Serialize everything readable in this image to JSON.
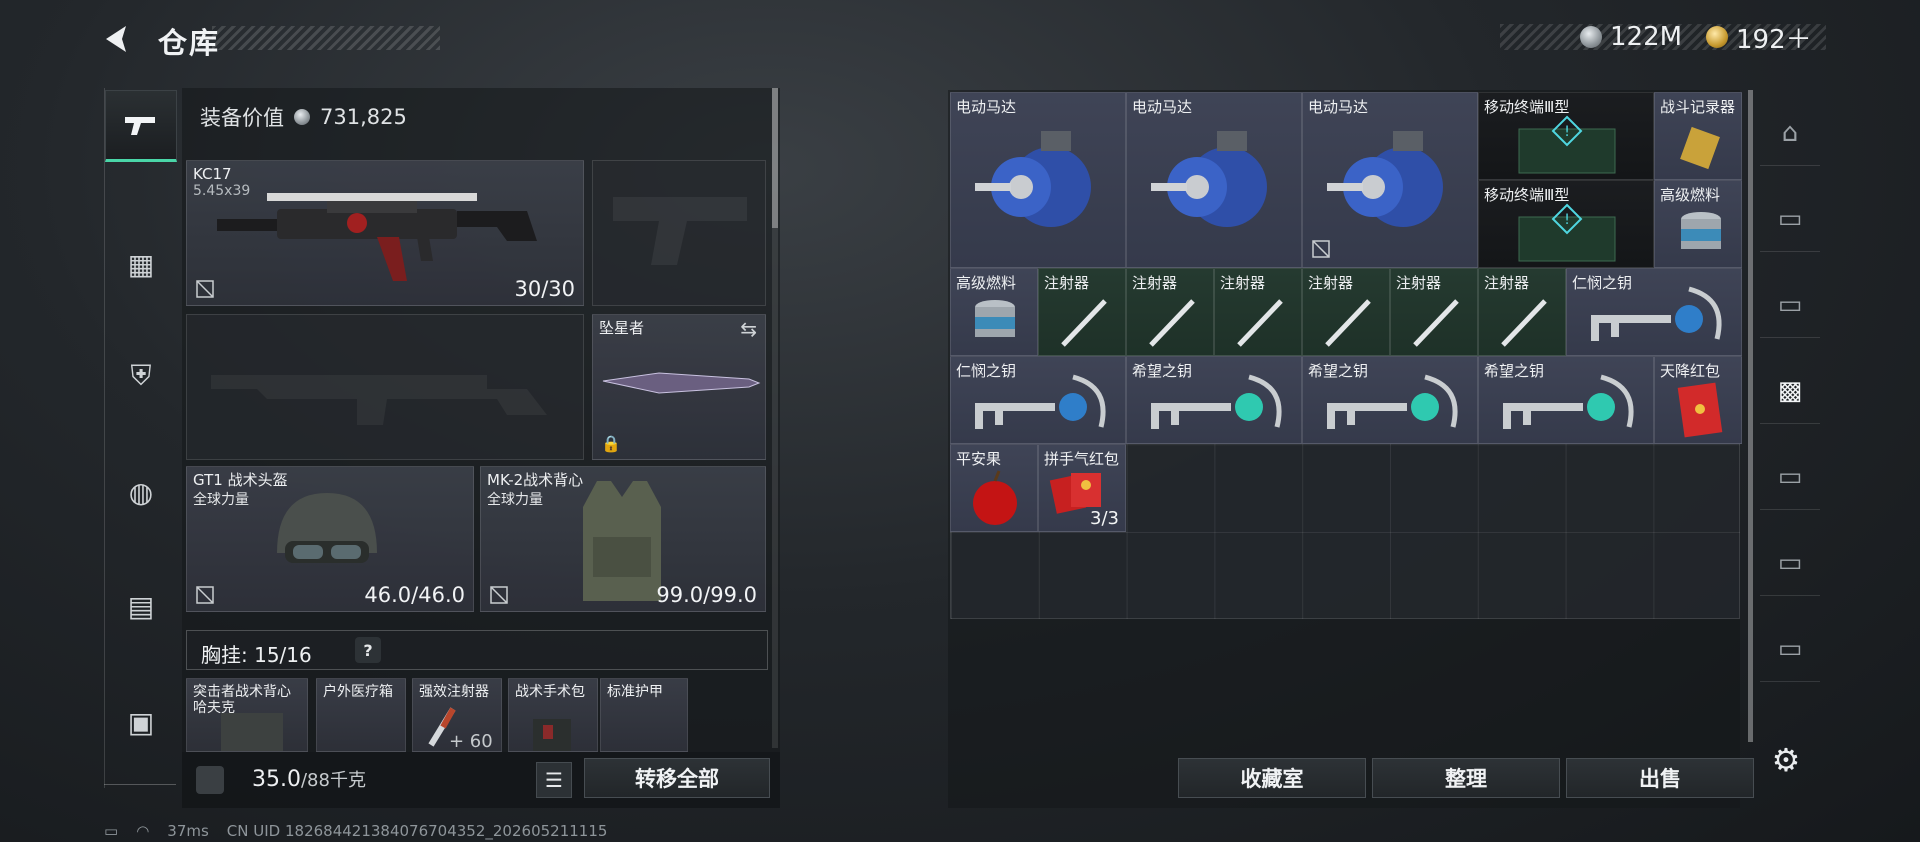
{
  "header": {
    "title": "仓库"
  },
  "currency": {
    "silver": "122M",
    "gold": "192＋"
  },
  "loadout": {
    "equip_value_label": "装备价值",
    "equip_value": "731,825",
    "primary_weapon": {
      "name": "KC17",
      "caliber": "5.45x39",
      "ammo": "30/30"
    },
    "melee": {
      "name": "坠星者"
    },
    "helmet": {
      "name": "GT1 战术头盔",
      "maker": "全球力量",
      "durability": "46.0/46.0"
    },
    "armor": {
      "name": "MK-2战术背心",
      "maker": "全球力量",
      "durability": "99.0/99.0"
    },
    "chest_rig_label": "胸挂: 15/16",
    "rig_items": [
      {
        "name": "突击者战术背心",
        "sub": "哈夫克"
      },
      {
        "name": "户外医疗箱"
      },
      {
        "name": "强效注射器",
        "count": "+ 60"
      },
      {
        "name": "战术手术包"
      },
      {
        "name": "标准护甲"
      }
    ],
    "weight": "35.0",
    "weight_max": "/88千克",
    "transfer_all": "转移全部"
  },
  "stash": {
    "items": [
      {
        "label": "电动马达"
      },
      {
        "label": "电动马达"
      },
      {
        "label": "电动马达"
      },
      {
        "label": "移动终端Ⅲ型"
      },
      {
        "label": "战斗记录器"
      },
      {
        "label": "移动终端Ⅲ型"
      },
      {
        "label": "高级燃料"
      },
      {
        "label": "高级燃料"
      },
      {
        "label": "注射器"
      },
      {
        "label": "注射器"
      },
      {
        "label": "注射器"
      },
      {
        "label": "注射器"
      },
      {
        "label": "注射器"
      },
      {
        "label": "注射器"
      },
      {
        "label": "仁悯之钥"
      },
      {
        "label": "仁悯之钥"
      },
      {
        "label": "希望之钥"
      },
      {
        "label": "希望之钥"
      },
      {
        "label": "希望之钥"
      },
      {
        "label": "天降红包"
      },
      {
        "label": "平安果"
      },
      {
        "label": "拼手气红包",
        "count": "3/3"
      }
    ],
    "buttons": {
      "collection": "收藏室",
      "sort": "整理",
      "sell": "出售"
    }
  },
  "status": {
    "ping": "37ms",
    "uid": "CN UID 182684421384076704352_202605211115"
  }
}
